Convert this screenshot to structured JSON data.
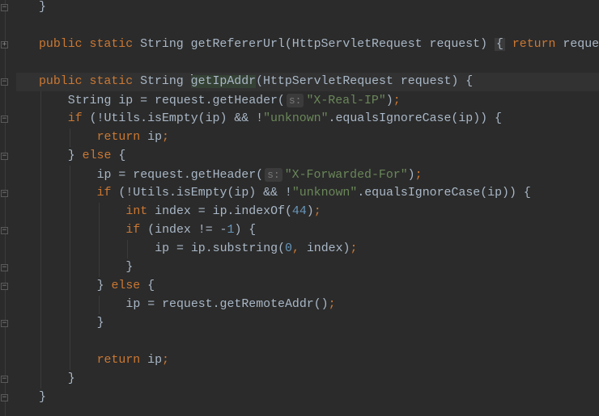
{
  "colors": {
    "background": "#2b2b2b",
    "text": "#a9b7c6",
    "keyword": "#cc7832",
    "string": "#6a8759",
    "number": "#6897bb",
    "hint": "#787878",
    "current_line": "#323232"
  },
  "editor": {
    "current_line": 4,
    "lines": [
      {
        "indent": 0,
        "tokens": [
          [
            "plain",
            "}"
          ]
        ]
      },
      {
        "indent": 0,
        "tokens": []
      },
      {
        "indent": 0,
        "tokens": [
          [
            "kw",
            "public static "
          ],
          [
            "plain",
            "String getRefererUrl(HttpServletRequest request) "
          ],
          [
            "fold",
            "{"
          ],
          [
            "plain",
            " "
          ],
          [
            "kw",
            "return "
          ],
          [
            "plain",
            "reque"
          ]
        ]
      },
      {
        "indent": 0,
        "tokens": []
      },
      {
        "indent": 0,
        "tokens": [
          [
            "kw",
            "public static "
          ],
          [
            "plain",
            "String "
          ],
          [
            "caret",
            ""
          ],
          [
            "sel",
            "getIpAddr"
          ],
          [
            "plain",
            "(HttpServletRequest request) {"
          ]
        ]
      },
      {
        "indent": 1,
        "tokens": [
          [
            "plain",
            "String ip = request.getHeader("
          ],
          [
            "hint",
            "s:"
          ],
          [
            "str",
            "\"X-Real-IP\""
          ],
          [
            "plain",
            ")"
          ],
          [
            "kw",
            ";"
          ]
        ]
      },
      {
        "indent": 1,
        "tokens": [
          [
            "kw",
            "if "
          ],
          [
            "plain",
            "(!Utils.isEmpty(ip) && !"
          ],
          [
            "str",
            "\"unknown\""
          ],
          [
            "plain",
            ".equalsIgnoreCase(ip)) {"
          ]
        ]
      },
      {
        "indent": 2,
        "tokens": [
          [
            "kw",
            "return "
          ],
          [
            "plain",
            "ip"
          ],
          [
            "kw",
            ";"
          ]
        ]
      },
      {
        "indent": 1,
        "tokens": [
          [
            "plain",
            "} "
          ],
          [
            "kw",
            "else "
          ],
          [
            "plain",
            "{"
          ]
        ]
      },
      {
        "indent": 2,
        "tokens": [
          [
            "plain",
            "ip = request.getHeader("
          ],
          [
            "hint",
            "s:"
          ],
          [
            "str",
            "\"X-Forwarded-For\""
          ],
          [
            "plain",
            ")"
          ],
          [
            "kw",
            ";"
          ]
        ]
      },
      {
        "indent": 2,
        "tokens": [
          [
            "kw",
            "if "
          ],
          [
            "plain",
            "(!Utils.isEmpty(ip) && !"
          ],
          [
            "str",
            "\"unknown\""
          ],
          [
            "plain",
            ".equalsIgnoreCase(ip)) {"
          ]
        ]
      },
      {
        "indent": 3,
        "tokens": [
          [
            "kw",
            "int "
          ],
          [
            "plain",
            "index = ip.indexOf("
          ],
          [
            "num",
            "44"
          ],
          [
            "plain",
            ")"
          ],
          [
            "kw",
            ";"
          ]
        ]
      },
      {
        "indent": 3,
        "tokens": [
          [
            "kw",
            "if "
          ],
          [
            "plain",
            "(index != -"
          ],
          [
            "num",
            "1"
          ],
          [
            "plain",
            ") {"
          ]
        ]
      },
      {
        "indent": 4,
        "tokens": [
          [
            "plain",
            "ip = ip.substring("
          ],
          [
            "num",
            "0"
          ],
          [
            "kw",
            ", "
          ],
          [
            "plain",
            "index)"
          ],
          [
            "kw",
            ";"
          ]
        ]
      },
      {
        "indent": 3,
        "tokens": [
          [
            "plain",
            "}"
          ]
        ]
      },
      {
        "indent": 2,
        "tokens": [
          [
            "plain",
            "} "
          ],
          [
            "kw",
            "else "
          ],
          [
            "plain",
            "{"
          ]
        ]
      },
      {
        "indent": 3,
        "tokens": [
          [
            "plain",
            "ip = request.getRemoteAddr()"
          ],
          [
            "kw",
            ";"
          ]
        ]
      },
      {
        "indent": 2,
        "tokens": [
          [
            "plain",
            "}"
          ]
        ]
      },
      {
        "indent": 0,
        "tokens": []
      },
      {
        "indent": 2,
        "tokens": [
          [
            "kw",
            "return "
          ],
          [
            "plain",
            "ip"
          ],
          [
            "kw",
            ";"
          ]
        ]
      },
      {
        "indent": 1,
        "tokens": [
          [
            "plain",
            "}"
          ]
        ]
      },
      {
        "indent": 0,
        "tokens": [
          [
            "plain",
            "}"
          ]
        ]
      }
    ],
    "fold_markers": [
      {
        "line": 0,
        "symbol": "−"
      },
      {
        "line": 2,
        "symbol": "+"
      },
      {
        "line": 4,
        "symbol": "−"
      },
      {
        "line": 6,
        "symbol": "−"
      },
      {
        "line": 8,
        "symbol": "−"
      },
      {
        "line": 10,
        "symbol": "−"
      },
      {
        "line": 12,
        "symbol": "−"
      },
      {
        "line": 14,
        "symbol": "−"
      },
      {
        "line": 15,
        "symbol": "−"
      },
      {
        "line": 17,
        "symbol": "−"
      },
      {
        "line": 20,
        "symbol": "−"
      },
      {
        "line": 21,
        "symbol": "−"
      }
    ]
  }
}
